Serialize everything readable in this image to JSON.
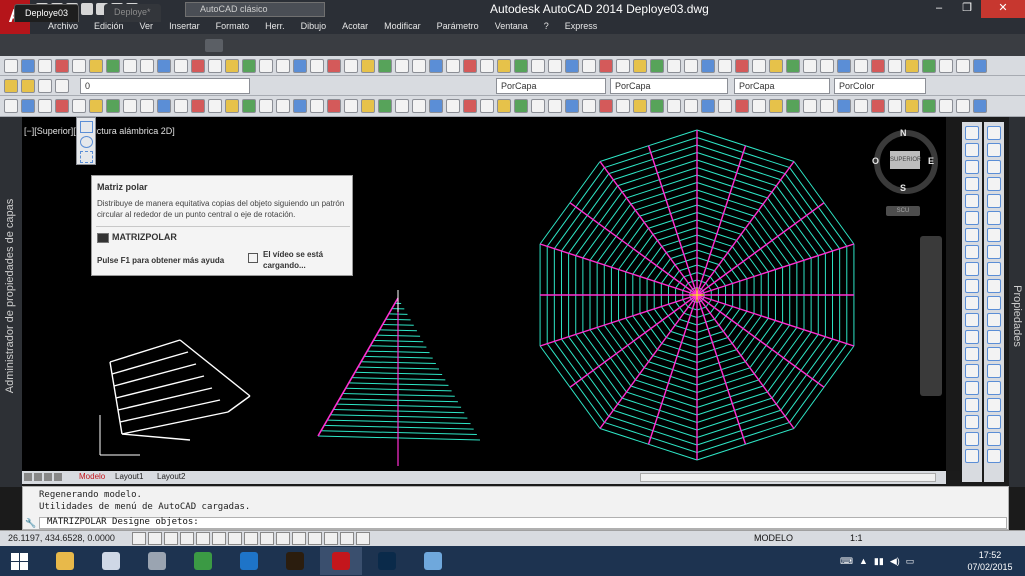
{
  "app": {
    "window_title": "Autodesk AutoCAD 2014    Deploye03.dwg",
    "workspace": "AutoCAD clásico",
    "logo_icon": "autocad-logo-icon"
  },
  "menus": [
    "Archivo",
    "Edición",
    "Ver",
    "Insertar",
    "Formato",
    "Herr.",
    "Dibujo",
    "Acotar",
    "Modificar",
    "Parámetro",
    "Ventana",
    "?",
    "Express"
  ],
  "tabs": {
    "active": "Deploye03",
    "inactive": "Deploye*"
  },
  "toolbar": {
    "layer_value": "0",
    "color_value": "PorCapa",
    "linetype_value": "PorCapa",
    "lineweight_value": "PorCapa",
    "plotstyle_value": "PorColor"
  },
  "viewport": {
    "label": "[−][Superior][Estructura alámbrica 2D]"
  },
  "viewcube": {
    "north": "N",
    "south": "S",
    "east": "E",
    "west": "O",
    "face": "SUPERIOR",
    "wcs": "SCU"
  },
  "palettes": {
    "left": "Administrador de propiedades de capas",
    "right": "Propiedades"
  },
  "tooltip": {
    "title": "Matriz polar",
    "description": "Distribuye de manera equitativa copias del objeto siguiendo un patrón circular al rededor de un punto central o eje de rotación.",
    "command": "MATRIZPOLAR",
    "help": "Pulse F1 para obtener más ayuda",
    "video": "El vídeo se está cargando..."
  },
  "layout_tabs": [
    "Modelo",
    "Layout1",
    "Layout2"
  ],
  "command": {
    "history": [
      "Regenerando modelo.",
      "Utilidades de menú de AutoCAD cargadas."
    ],
    "prompt": "MATRIZPOLAR Designe objetos:"
  },
  "status": {
    "coordinates": "26.1197, 434.6528, 0.0000",
    "space": "MODELO",
    "scale": "1:1"
  },
  "taskbar": {
    "time": "17:52",
    "date": "07/02/2015",
    "apps": [
      "file-explorer-icon",
      "notepad-icon",
      "network-icon",
      "chrome-icon",
      "internet-explorer-icon",
      "illustrator-icon",
      "autocad-icon",
      "photoshop-icon",
      "paint-icon"
    ]
  },
  "colors": {
    "cyan_lines": "#2ee6c6",
    "magenta": "#ff2fd2",
    "background": "#000000",
    "autocad_red": "#c4161c"
  }
}
